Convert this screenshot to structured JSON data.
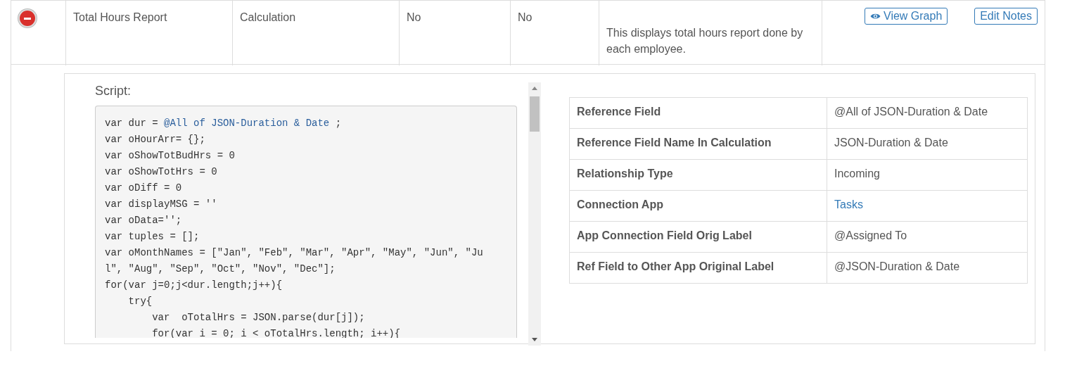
{
  "row": {
    "expanded": true,
    "cells": [
      "Total Hours Report",
      "Calculation",
      "No",
      "No"
    ],
    "description": "This displays total hours report done by each employee.",
    "buttons": [
      {
        "label": "View Graph",
        "kind": "graph"
      },
      {
        "label": "Edit Notes",
        "kind": "plain"
      }
    ]
  },
  "detail": {
    "script_label": "Script:",
    "code": [
      [
        {
          "text": "var dur = ",
          "kind": "plain"
        },
        {
          "text": "@All of JSON-Duration & Date",
          "kind": "ref"
        },
        {
          "text": " ;",
          "kind": "plain"
        }
      ],
      [
        {
          "text": "var oHourArr= {};",
          "kind": "plain"
        }
      ],
      [
        {
          "text": "var oShowTotBudHrs = 0",
          "kind": "plain"
        }
      ],
      [
        {
          "text": "var oShowTotHrs = 0",
          "kind": "plain"
        }
      ],
      [
        {
          "text": "var oDiff = 0",
          "kind": "plain"
        }
      ],
      [
        {
          "text": "var displayMSG = ''",
          "kind": "plain"
        }
      ],
      [
        {
          "text": "var oData='';",
          "kind": "plain"
        }
      ],
      [
        {
          "text": "var tuples = [];",
          "kind": "plain"
        }
      ],
      [
        {
          "text": "var oMonthNames = [\"Jan\", \"Feb\", \"Mar\", \"Apr\", \"May\", \"Jun\", \"Ju",
          "kind": "plain"
        }
      ],
      [
        {
          "text": "l\", \"Aug\", \"Sep\", \"Oct\", \"Nov\", \"Dec\"];",
          "kind": "plain"
        }
      ],
      [
        {
          "text": "for(var j=0;j<dur.length;j++){",
          "kind": "plain"
        }
      ],
      [
        {
          "text": "    try{",
          "kind": "plain"
        }
      ],
      [
        {
          "text": "        var  oTotalHrs = JSON.parse(dur[j]);",
          "kind": "plain"
        }
      ],
      [
        {
          "text": "        for(var i = 0; i < oTotalHrs.length; i++){",
          "kind": "plain"
        }
      ]
    ],
    "properties": [
      {
        "label": "Reference Field",
        "value": "@All of JSON-Duration & Date",
        "kind": "text"
      },
      {
        "label": "Reference Field Name In Calculation",
        "value": "JSON-Duration & Date",
        "kind": "text"
      },
      {
        "label": "Relationship Type",
        "value": "Incoming",
        "kind": "text"
      },
      {
        "label": "Connection App",
        "value": "Tasks",
        "kind": "link"
      },
      {
        "label": "App Connection Field Orig Label",
        "value": "@Assigned To",
        "kind": "text"
      },
      {
        "label": "Ref Field to Other App Original Label",
        "value": "@JSON-Duration & Date",
        "kind": "text"
      }
    ]
  }
}
